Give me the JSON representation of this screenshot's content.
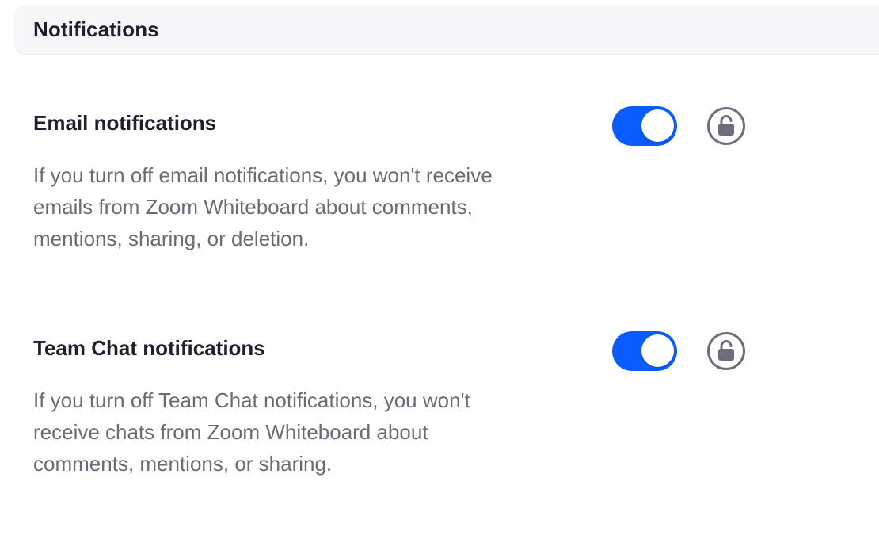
{
  "section": {
    "title": "Notifications"
  },
  "settings": [
    {
      "title": "Email notifications",
      "description": "If you turn off email notifications, you won't receive\nemails from Zoom Whiteboard about comments,\nmentions, sharing, or deletion.",
      "toggle_on": true,
      "lock_icon": "unlocked-lock-icon"
    },
    {
      "title": "Team Chat notifications",
      "description": "If you turn off Team Chat notifications, you won't\nreceive chats from Zoom Whiteboard about\ncomments, mentions, or sharing.",
      "toggle_on": true,
      "lock_icon": "unlocked-lock-icon"
    }
  ],
  "colors": {
    "toggle_on": "#0b5cff",
    "title_text": "#1f1f2e",
    "description_text": "#6b6b78",
    "header_background": "#f7f7f9",
    "lock_icon": "#6e6e7a"
  }
}
